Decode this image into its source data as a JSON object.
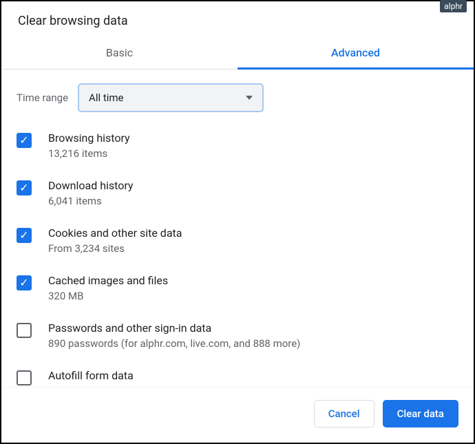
{
  "watermark": "alphr",
  "dialog": {
    "title": "Clear browsing data",
    "tabs": {
      "basic": "Basic",
      "advanced": "Advanced"
    },
    "time_range": {
      "label": "Time range",
      "value": "All time"
    },
    "items": [
      {
        "checked": true,
        "title": "Browsing history",
        "sub": "13,216 items"
      },
      {
        "checked": true,
        "title": "Download history",
        "sub": "6,041 items"
      },
      {
        "checked": true,
        "title": "Cookies and other site data",
        "sub": "From 3,234 sites"
      },
      {
        "checked": true,
        "title": "Cached images and files",
        "sub": "320 MB"
      },
      {
        "checked": false,
        "title": "Passwords and other sign-in data",
        "sub": "890 passwords (for alphr.com, live.com, and 888 more)"
      },
      {
        "checked": false,
        "title": "Autofill form data",
        "sub": ""
      }
    ],
    "buttons": {
      "cancel": "Cancel",
      "clear": "Clear data"
    }
  }
}
